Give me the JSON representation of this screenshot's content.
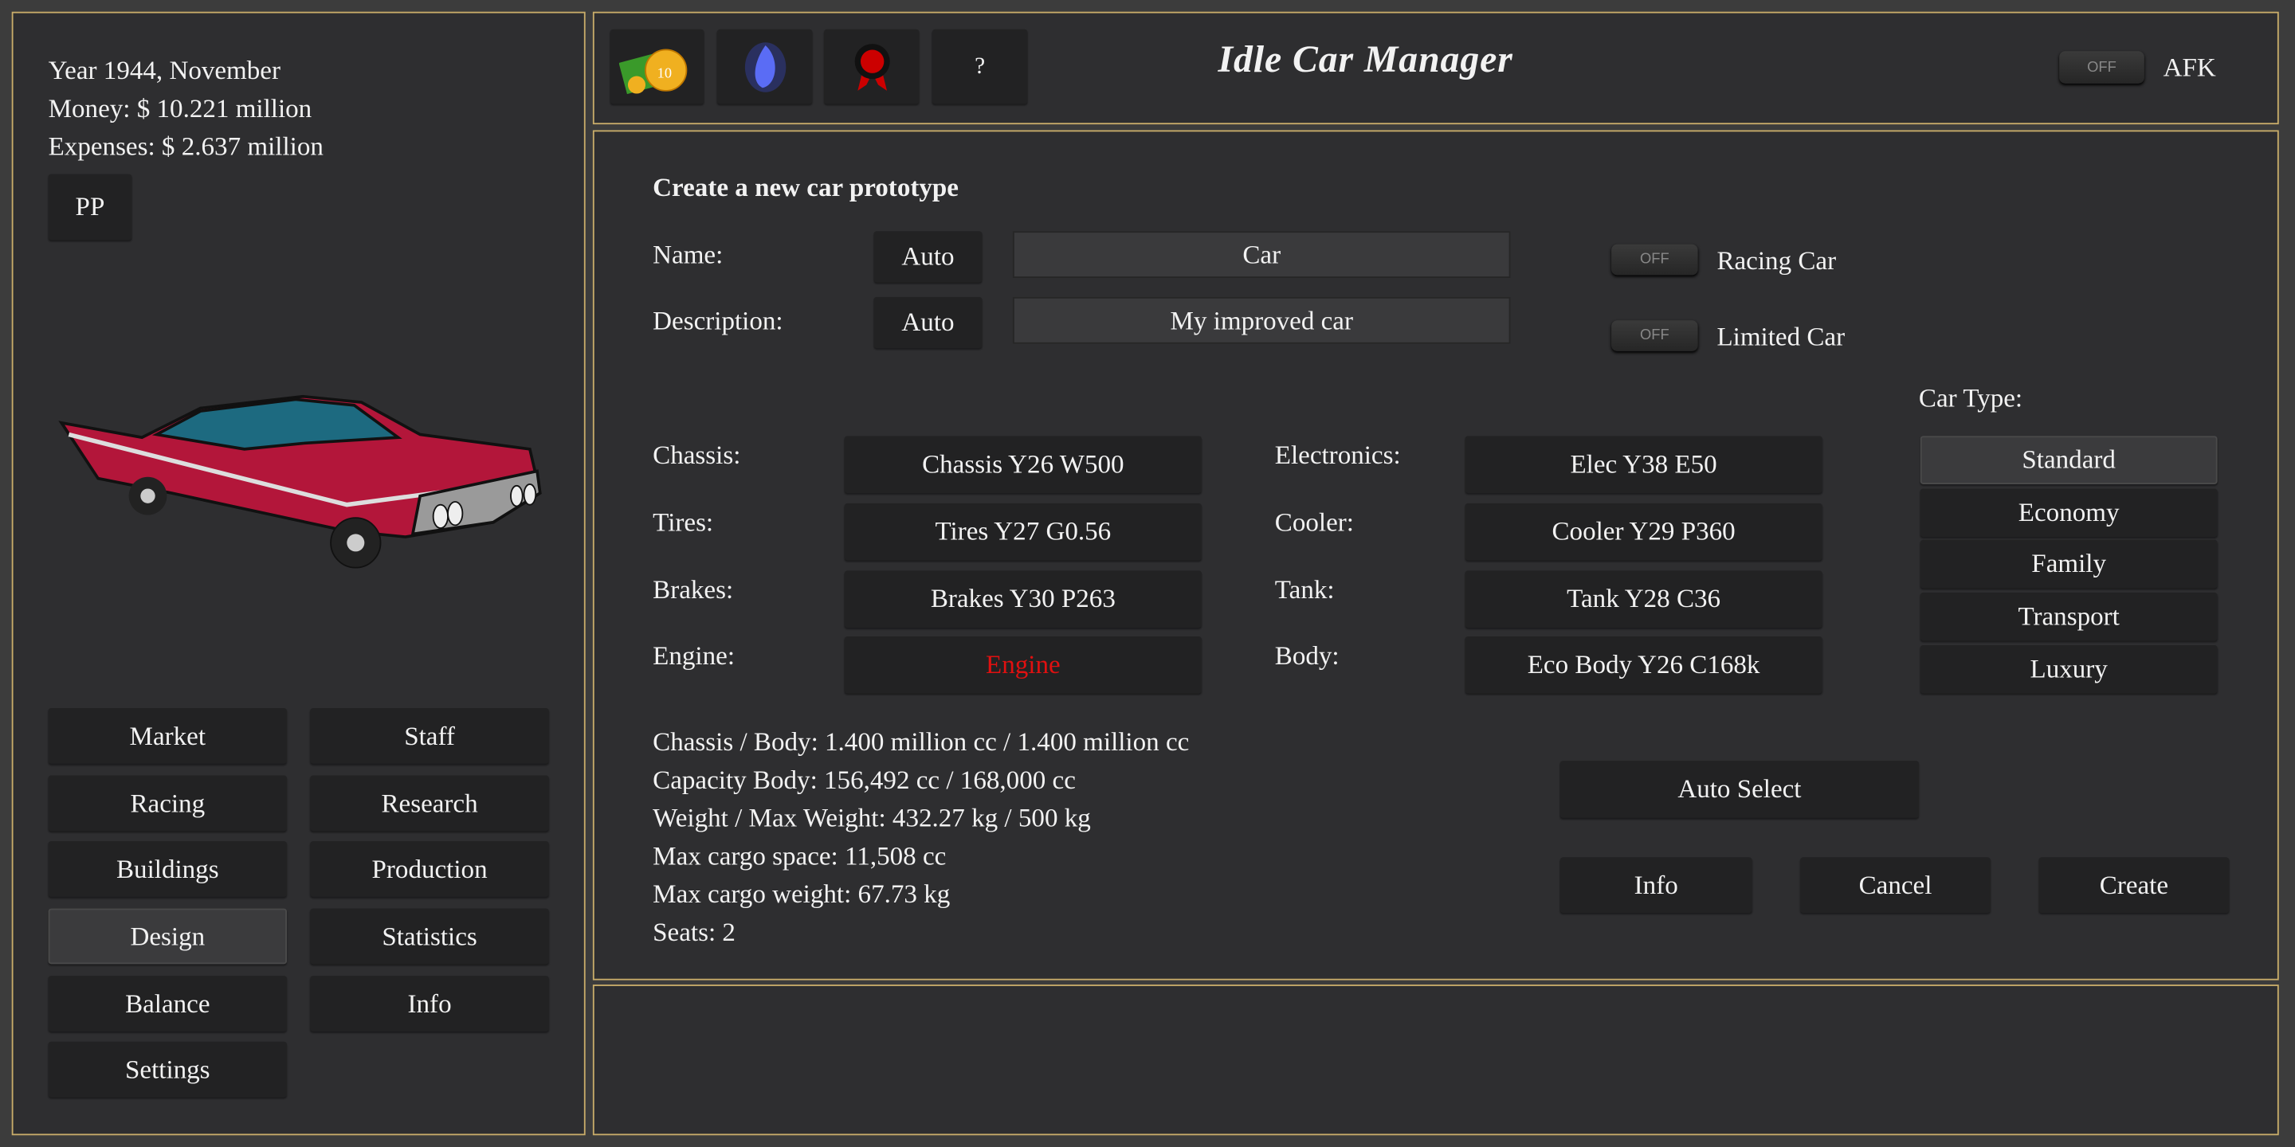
{
  "status": {
    "year": "Year 1944, November",
    "money": "Money: $ 10.221 million",
    "expenses": "Expenses: $ 2.637 million",
    "pp_label": "PP"
  },
  "nav": [
    {
      "label": "Market"
    },
    {
      "label": "Staff"
    },
    {
      "label": "Racing"
    },
    {
      "label": "Research"
    },
    {
      "label": "Buildings"
    },
    {
      "label": "Production"
    },
    {
      "label": "Design",
      "selected": true
    },
    {
      "label": "Statistics"
    },
    {
      "label": "Balance"
    },
    {
      "label": "Info"
    },
    {
      "label": "Settings"
    }
  ],
  "header": {
    "title": "Idle Car Manager",
    "icons": [
      "money-icon",
      "blue-flame-icon",
      "award-ribbon-icon"
    ],
    "help_label": "?",
    "afk_toggle": "OFF",
    "afk_label": "AFK"
  },
  "form": {
    "heading": "Create a new car prototype",
    "name_label": "Name:",
    "name_auto": "Auto",
    "name_value": "Car",
    "desc_label": "Description:",
    "desc_auto": "Auto",
    "desc_value": "My improved car",
    "racing_toggle": "OFF",
    "racing_label": "Racing Car",
    "limited_toggle": "OFF",
    "limited_label": "Limited Car",
    "car_type_label": "Car Type:",
    "car_types": [
      {
        "label": "Standard",
        "selected": true
      },
      {
        "label": "Economy"
      },
      {
        "label": "Family"
      },
      {
        "label": "Transport"
      },
      {
        "label": "Luxury"
      }
    ],
    "parts_left": [
      {
        "label": "Chassis:",
        "value": "Chassis Y26 W500"
      },
      {
        "label": "Tires:",
        "value": "Tires Y27 G0.56"
      },
      {
        "label": "Brakes:",
        "value": "Brakes Y30 P263"
      },
      {
        "label": "Engine:",
        "value": "Engine",
        "missing": true
      }
    ],
    "parts_right": [
      {
        "label": "Electronics:",
        "value": "Elec Y38 E50"
      },
      {
        "label": "Cooler:",
        "value": "Cooler Y29 P360"
      },
      {
        "label": "Tank:",
        "value": "Tank Y28 C36"
      },
      {
        "label": "Body:",
        "value": "Eco Body Y26 C168k"
      }
    ],
    "stats": [
      "Chassis / Body: 1.400 million cc / 1.400 million cc",
      "Capacity Body: 156,492 cc / 168,000 cc",
      "Weight / Max Weight: 432.27 kg / 500 kg",
      "Max cargo space: 11,508 cc",
      "Max cargo weight: 67.73 kg",
      "Seats: 2"
    ],
    "auto_select": "Auto Select",
    "info": "Info",
    "cancel": "Cancel",
    "create": "Create"
  },
  "colors": {
    "border": "#c9ad6a",
    "panel": "#2e2e30",
    "button": "#222223",
    "missing": "#e01010",
    "car_body": "#b3163a",
    "car_window": "#1d6a80"
  }
}
